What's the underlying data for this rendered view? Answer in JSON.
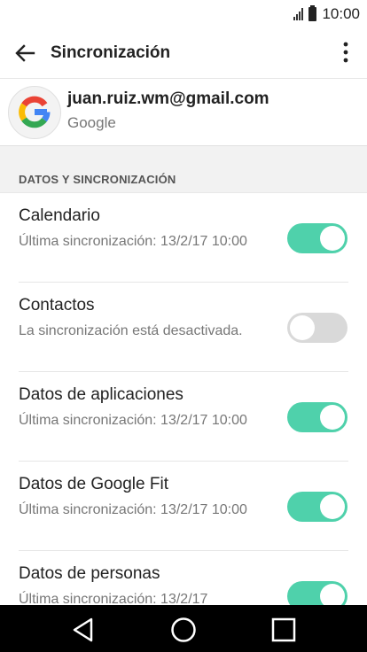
{
  "status_bar": {
    "time": "10:00"
  },
  "app_bar": {
    "title": "Sincronización"
  },
  "account": {
    "email": "juan.ruiz.wm@gmail.com",
    "provider": "Google"
  },
  "section": {
    "title": "DATOS Y SINCRONIZACIÓN"
  },
  "items": [
    {
      "title": "Calendario",
      "subtitle": "Última sincronización: 13/2/17 10:00",
      "enabled": true
    },
    {
      "title": "Contactos",
      "subtitle": "La sincronización está desactivada.",
      "enabled": false
    },
    {
      "title": "Datos de aplicaciones",
      "subtitle": "Última sincronización: 13/2/17 10:00",
      "enabled": true
    },
    {
      "title": "Datos de Google Fit",
      "subtitle": "Última sincronización: 13/2/17 10:00",
      "enabled": true
    },
    {
      "title": "Datos de personas",
      "subtitle": "Última sincronización: 13/2/17",
      "enabled": true
    }
  ],
  "colors": {
    "toggle_on": "#4fd1ab",
    "toggle_off": "#d9d9d9",
    "nav_bar": "#000000"
  },
  "icons": [
    "signal-icon",
    "battery-icon",
    "back-arrow-icon",
    "more-vert-icon",
    "google-logo-icon",
    "nav-back-icon",
    "nav-home-icon",
    "nav-recents-icon"
  ]
}
